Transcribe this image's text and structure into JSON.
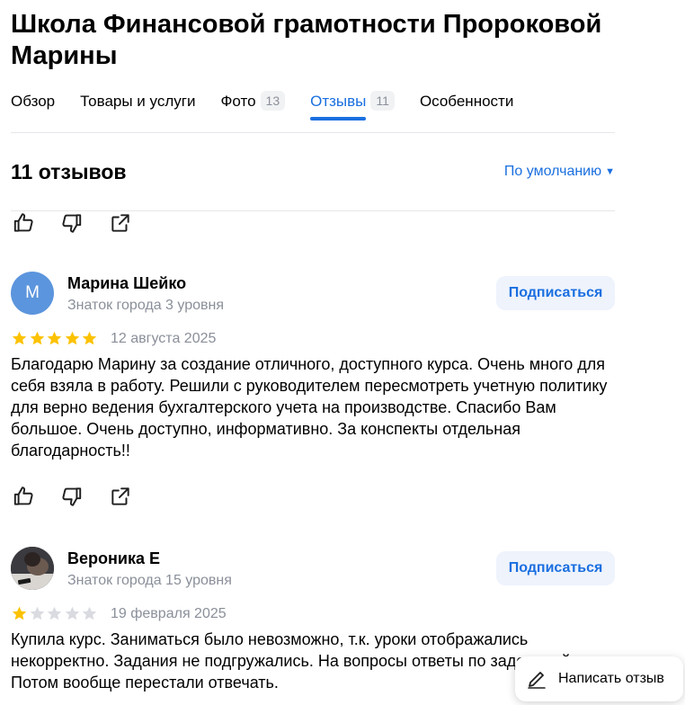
{
  "header": {
    "title": "Школа Финансовой грамотности Пророковой Марины"
  },
  "tabs": [
    {
      "label": "Обзор",
      "count": null,
      "active": false
    },
    {
      "label": "Товары и услуги",
      "count": null,
      "active": false
    },
    {
      "label": "Фото",
      "count": "13",
      "active": false
    },
    {
      "label": "Отзывы",
      "count": "11",
      "active": true
    },
    {
      "label": "Особенности",
      "count": null,
      "active": false
    }
  ],
  "reviews_header": {
    "count_label": "11 отзывов",
    "sort_label": "По умолчанию",
    "sort_icon": "caret-down-icon"
  },
  "action_icons": [
    "like-icon",
    "dislike-icon",
    "share-icon"
  ],
  "reviews": [
    {
      "avatar_letter": "М",
      "avatar_type": "letter",
      "author": "Марина Шейко",
      "level": "Знаток города 3 уровня",
      "subscribe_label": "Подписаться",
      "rating": 5,
      "date": "12 августа 2025",
      "text": "Благодарю Марину за создание отличного, доступного курса. Очень много для себя взяла в работу. Решили с руководителем пересмотреть учетную политику для верно ведения бухгалтерского учета на производстве. Спасибо Вам большое. Очень доступно, информативно. За конспекты отдельная благодарность!!"
    },
    {
      "avatar_letter": "",
      "avatar_type": "photo",
      "author": "Вероника Е",
      "level": "Знаток города 15 уровня",
      "subscribe_label": "Подписаться",
      "rating": 1,
      "date": "19 февраля 2025",
      "text": "Купила курс. Заниматься было невозможно, т.к. уроки отображались некорректно. Задания не подгружались. На вопросы ответы по задержкой. Потом вообще перестали отвечать."
    }
  ],
  "write_review": {
    "label": "Написать отзыв",
    "icon": "pencil-icon"
  },
  "colors": {
    "accent": "#1a6fe0",
    "star_filled": "#fcc200",
    "star_empty": "#d9dbe0",
    "muted": "#8a8f99"
  }
}
